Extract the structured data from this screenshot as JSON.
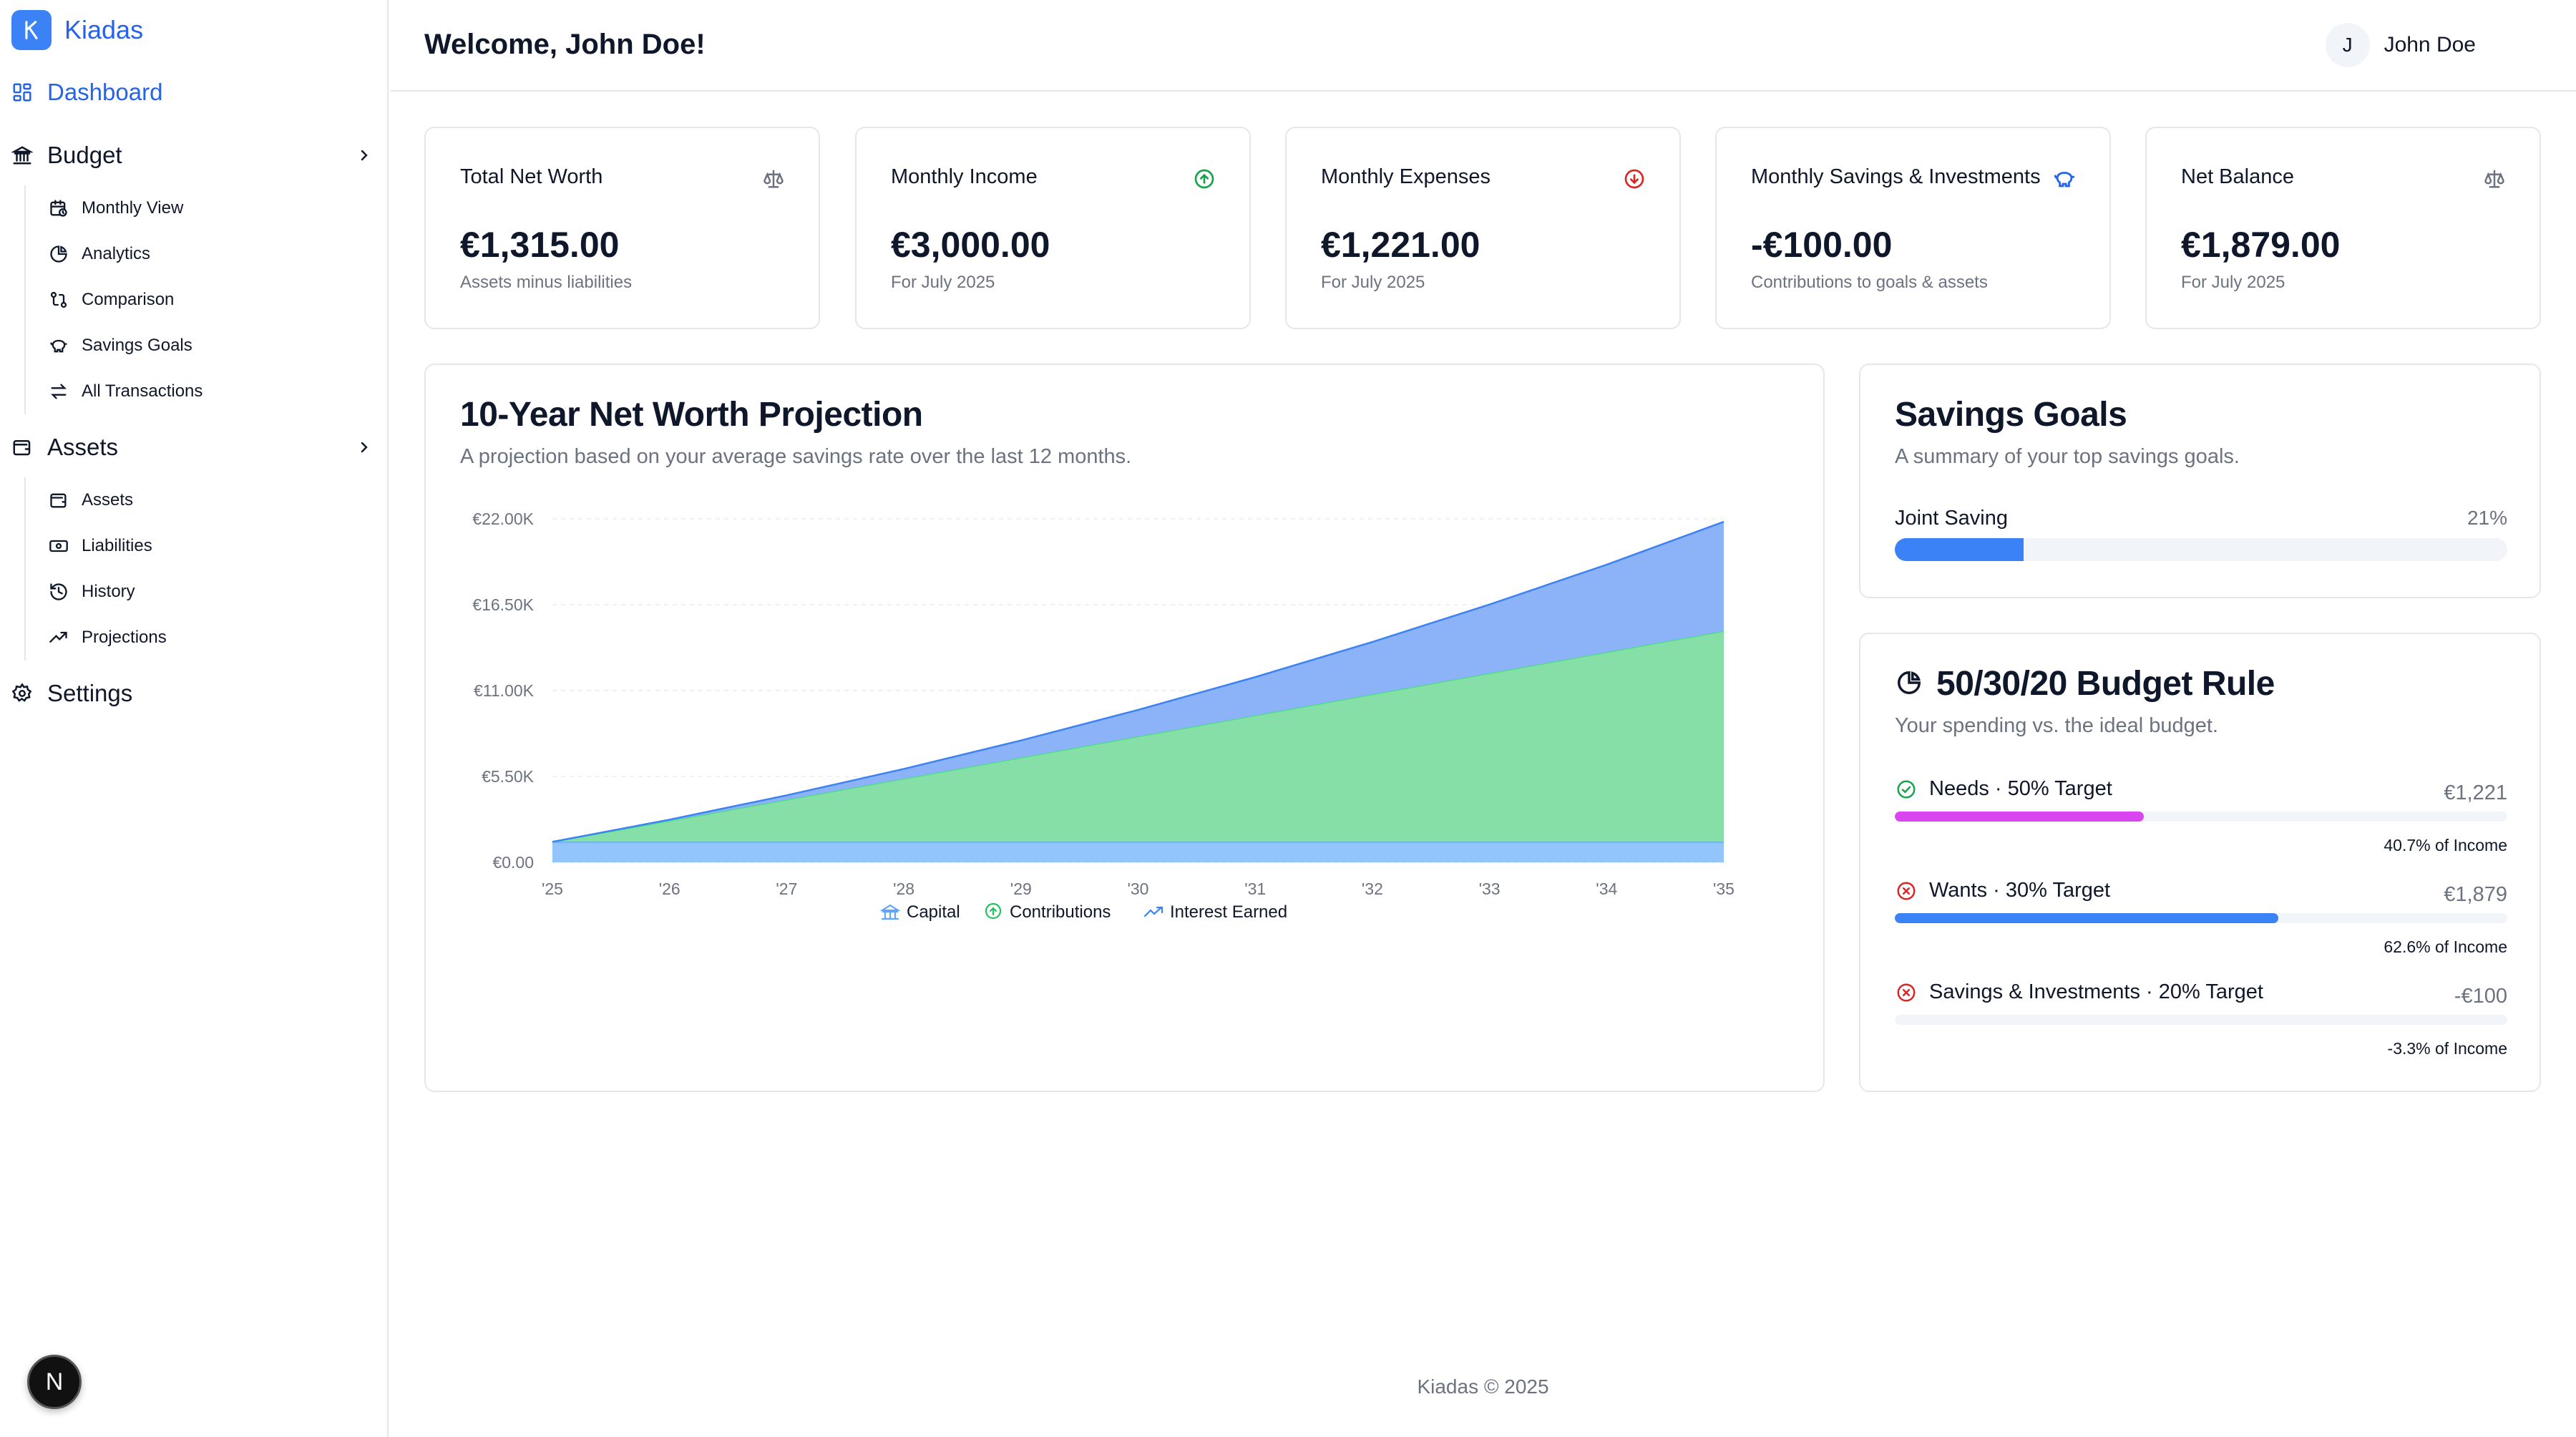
{
  "brand": {
    "name": "Kiadas",
    "logo_letter": "K",
    "accent": "#3b82f6"
  },
  "sidebar": {
    "dashboard": {
      "label": "Dashboard",
      "icon": "grid-icon"
    },
    "budget": {
      "label": "Budget",
      "items": [
        {
          "label": "Monthly View",
          "icon": "calendar-clock-icon"
        },
        {
          "label": "Analytics",
          "icon": "pie-chart-icon"
        },
        {
          "label": "Comparison",
          "icon": "git-compare-icon"
        },
        {
          "label": "Savings Goals",
          "icon": "piggy-bank-icon"
        },
        {
          "label": "All Transactions",
          "icon": "arrows-swap-icon"
        }
      ]
    },
    "assets": {
      "label": "Assets",
      "items": [
        {
          "label": "Assets",
          "icon": "wallet-icon"
        },
        {
          "label": "Liabilities",
          "icon": "banknote-icon"
        },
        {
          "label": "History",
          "icon": "history-icon"
        },
        {
          "label": "Projections",
          "icon": "trending-up-icon"
        }
      ]
    },
    "settings": {
      "label": "Settings",
      "icon": "gear-icon"
    },
    "dev_badge": "N"
  },
  "header": {
    "welcome": "Welcome, John Doe!",
    "user_initial": "J",
    "user_name": "John Doe"
  },
  "stats": [
    {
      "title": "Total Net Worth",
      "value": "€1,315.00",
      "sub": "Assets minus liabilities",
      "icon": "scale-icon",
      "icon_color": "#6b7280"
    },
    {
      "title": "Monthly Income",
      "value": "€3,000.00",
      "sub": "For July 2025",
      "icon": "arrow-up-circle-icon",
      "icon_color": "#16a34a"
    },
    {
      "title": "Monthly Expenses",
      "value": "€1,221.00",
      "sub": "For July 2025",
      "icon": "arrow-down-circle-icon",
      "icon_color": "#dc2626"
    },
    {
      "title": "Monthly Savings & Investments",
      "value": "-€100.00",
      "sub": "Contributions to goals & assets",
      "icon": "piggy-bank-icon",
      "icon_color": "#2563eb"
    },
    {
      "title": "Net Balance",
      "value": "€1,879.00",
      "sub": "For July 2025",
      "icon": "scale-icon",
      "icon_color": "#6b7280"
    }
  ],
  "projection": {
    "title": "10-Year Net Worth Projection",
    "subtitle": "A projection based on your average savings rate over the last 12 months."
  },
  "chart_data": {
    "type": "area",
    "stacked": true,
    "x": [
      "'25",
      "'26",
      "'27",
      "'28",
      "'29",
      "'30",
      "'31",
      "'32",
      "'33",
      "'34",
      "'35"
    ],
    "y_ticks": [
      "€0.00",
      "€5.50K",
      "€11.00K",
      "€16.50K",
      "€22.00K"
    ],
    "ylim": [
      0,
      22000
    ],
    "grid": true,
    "legend_position": "bottom",
    "series": [
      {
        "name": "Capital",
        "color": "#93c5fd",
        "icon": "bank-icon",
        "values": [
          1315,
          1315,
          1315,
          1315,
          1315,
          1315,
          1315,
          1315,
          1315,
          1315,
          1315
        ]
      },
      {
        "name": "Contributions",
        "color": "#86dfa6",
        "icon": "plus-circle-icon",
        "values": [
          0,
          1350,
          2700,
          4050,
          5400,
          6750,
          8100,
          9450,
          10800,
          12150,
          13500
        ]
      },
      {
        "name": "Interest Earned",
        "color": "#8cb3f7",
        "icon": "trending-up-icon",
        "values": [
          0,
          70,
          280,
          620,
          1090,
          1700,
          2450,
          3350,
          4400,
          5600,
          7000
        ]
      }
    ]
  },
  "savings_goals": {
    "title": "Savings Goals",
    "subtitle": "A summary of your top savings goals.",
    "goals": [
      {
        "name": "Joint Saving",
        "percent_label": "21%",
        "fraction": 0.21
      }
    ]
  },
  "budget_rule": {
    "title": "50/30/20 Budget Rule",
    "subtitle": "Your spending vs. the ideal budget.",
    "title_icon": "pie-chart-icon",
    "rows": [
      {
        "label": "Needs · 50% Target",
        "amount": "€1,221",
        "pct_label": "40.7% of Income",
        "fraction": 0.407,
        "color": "#d946ef",
        "status_icon": "check-circle-icon",
        "status_color": "#16a34a"
      },
      {
        "label": "Wants · 30% Target",
        "amount": "€1,879",
        "pct_label": "62.6% of Income",
        "fraction": 0.626,
        "color": "#3b82f6",
        "status_icon": "x-circle-icon",
        "status_color": "#dc2626"
      },
      {
        "label": "Savings & Investments · 20% Target",
        "amount": "-€100",
        "pct_label": "-3.3% of Income",
        "fraction": 0,
        "color": "#3b82f6",
        "status_icon": "x-circle-icon",
        "status_color": "#dc2626"
      }
    ]
  },
  "footer": "Kiadas © 2025"
}
